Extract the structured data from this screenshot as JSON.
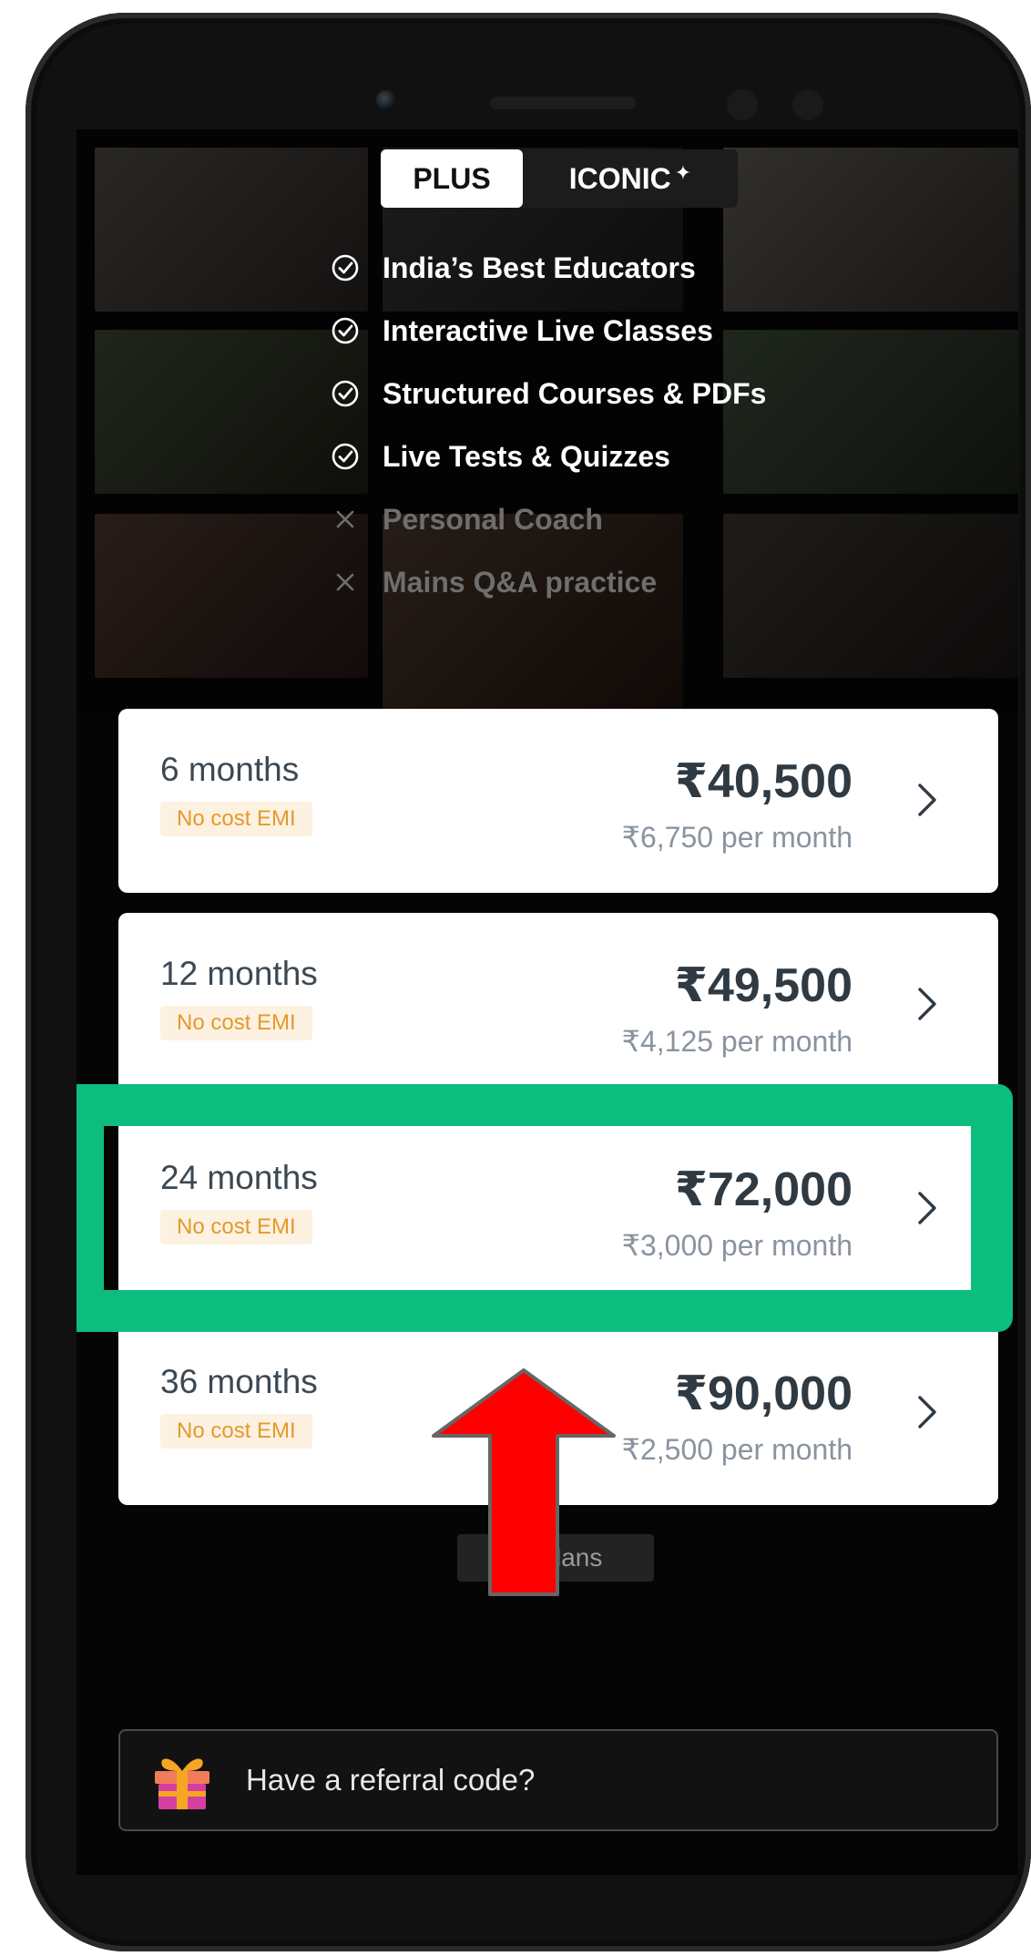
{
  "tabs": {
    "plus": "PLUS",
    "iconic": "ICONIC",
    "active": "PLUS"
  },
  "features": [
    {
      "label": "India’s Best Educators",
      "included": true
    },
    {
      "label": "Interactive Live Classes",
      "included": true
    },
    {
      "label": "Structured Courses & PDFs",
      "included": true
    },
    {
      "label": "Live Tests & Quizzes",
      "included": true
    },
    {
      "label": "Personal Coach",
      "included": false
    },
    {
      "label": "Mains Q&A practice",
      "included": false
    }
  ],
  "plans": [
    {
      "duration": "6 months",
      "badge": "No cost EMI",
      "price": "₹40,500",
      "monthly": "₹6,750 per month"
    },
    {
      "duration": "12 months",
      "badge": "No cost EMI",
      "price": "₹49,500",
      "monthly": "₹4,125 per month"
    },
    {
      "duration": "24 months",
      "badge": "No cost EMI",
      "price": "₹72,000",
      "monthly": "₹3,000 per month",
      "highlighted": true
    },
    {
      "duration": "36 months",
      "badge": "No cost EMI",
      "price": "₹90,000",
      "monthly": "₹2,500 per month"
    }
  ],
  "view_all": "all plans",
  "referral": {
    "label": "Have a referral code?"
  },
  "colors": {
    "highlight": "#0dbd7e",
    "arrow": "#ff0000",
    "emi_text": "#e39a2b",
    "emi_bg": "#fdf1e1"
  },
  "icons": {
    "included": "check-circle-icon",
    "excluded": "cross-icon",
    "chevron": "chevron-right-icon",
    "gift": "gift-icon",
    "sparkle": "sparkle-icon"
  }
}
